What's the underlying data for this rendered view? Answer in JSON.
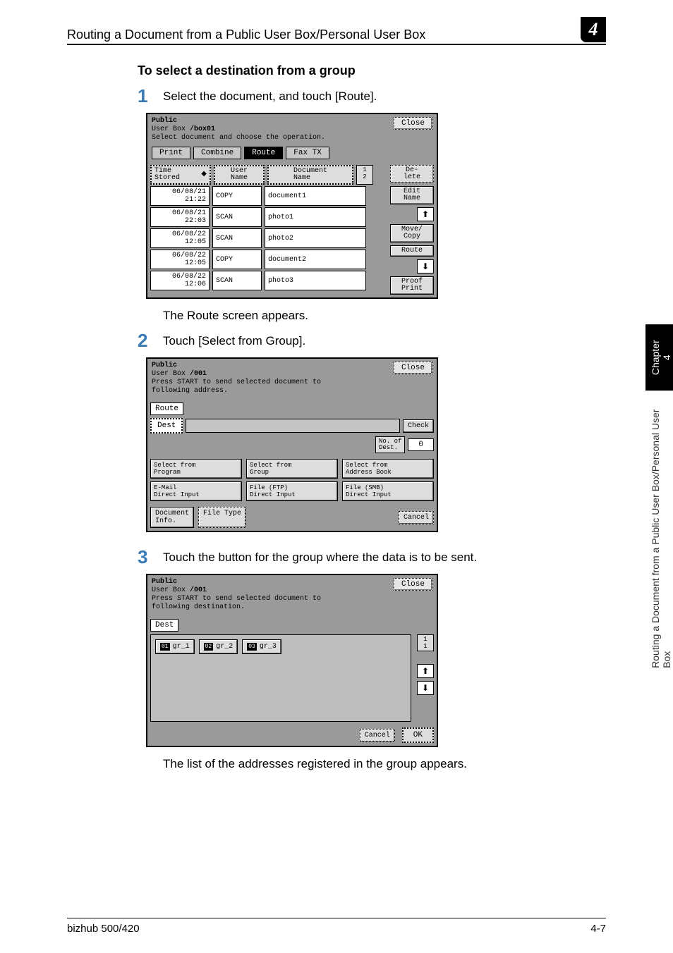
{
  "header": {
    "title": "Routing a Document from a Public User Box/Personal User Box",
    "chapter_num": "4"
  },
  "section_heading": "To select a destination from a group",
  "steps": {
    "s1": {
      "num": "1",
      "text": "Select the document, and touch [Route]."
    },
    "after1": "The Route screen appears.",
    "s2": {
      "num": "2",
      "text": "Touch [Select from Group]."
    },
    "s3": {
      "num": "3",
      "text": "Touch the button for the group where the data is to be sent."
    },
    "after3": "The list of the addresses registered in the group appears."
  },
  "screen1": {
    "line1": "Public",
    "line1b": "User Box",
    "boxid": "/box01",
    "subtitle": "Select document and choose the operation.",
    "close": "Close",
    "tabs": {
      "print": "Print",
      "combine": "Combine",
      "route": "Route",
      "fax": "Fax TX"
    },
    "cols": {
      "time": "Time\nStored",
      "user": "User\nName",
      "doc": "Document\nName"
    },
    "page": "1\n2",
    "rows": [
      {
        "t": "06/08/21\n21:22",
        "u": "COPY",
        "d": "document1"
      },
      {
        "t": "06/08/21\n22:03",
        "u": "SCAN",
        "d": "photo1"
      },
      {
        "t": "06/08/22\n12:05",
        "u": "SCAN",
        "d": "photo2"
      },
      {
        "t": "06/08/22\n12:05",
        "u": "COPY",
        "d": "document2"
      },
      {
        "t": "06/08/22\n12:06",
        "u": "SCAN",
        "d": "photo3"
      }
    ],
    "side": {
      "del": "De-\nlete",
      "edit": "Edit\nName",
      "move": "Move/\nCopy",
      "route": "Route",
      "proof": "Proof\nPrint"
    },
    "up": "⬆",
    "down": "⬇"
  },
  "screen2": {
    "line1": "Public",
    "line1b": "User Box",
    "boxid": "/001",
    "subtitle": "Press START to send selected document to\nfollowing address.",
    "close": "Close",
    "route": "Route",
    "dest": "Dest",
    "check": "Check",
    "ndestlbl": "No. of\nDest.",
    "ndestval": "0",
    "opts": {
      "a": "Select from\nProgram",
      "b": "Select from\nGroup",
      "c": "Select from\nAddress Book",
      "d": "E-Mail\nDirect Input",
      "e": "File (FTP)\nDirect Input",
      "f": "File (SMB)\nDirect Input"
    },
    "docinfo": "Document\nInfo.",
    "filetype": "File Type",
    "cancel": "Cancel"
  },
  "screen3": {
    "line1": "Public",
    "line1b": "User Box",
    "boxid": "/001",
    "subtitle": "Press START to send selected document to\nfollowing destination.",
    "close": "Close",
    "dest": "Dest",
    "g1n": "01",
    "g1": "gr_1",
    "g2n": "02",
    "g2": "gr_2",
    "g3n": "03",
    "g3": "gr_3",
    "page": "1\n1",
    "up": "⬆",
    "down": "⬇",
    "cancel": "Cancel",
    "ok": "OK"
  },
  "side": {
    "black": "Chapter 4",
    "grey": "Routing a Document from a Public User Box/Personal User Box"
  },
  "footer": {
    "left": "bizhub 500/420",
    "right": "4-7"
  }
}
